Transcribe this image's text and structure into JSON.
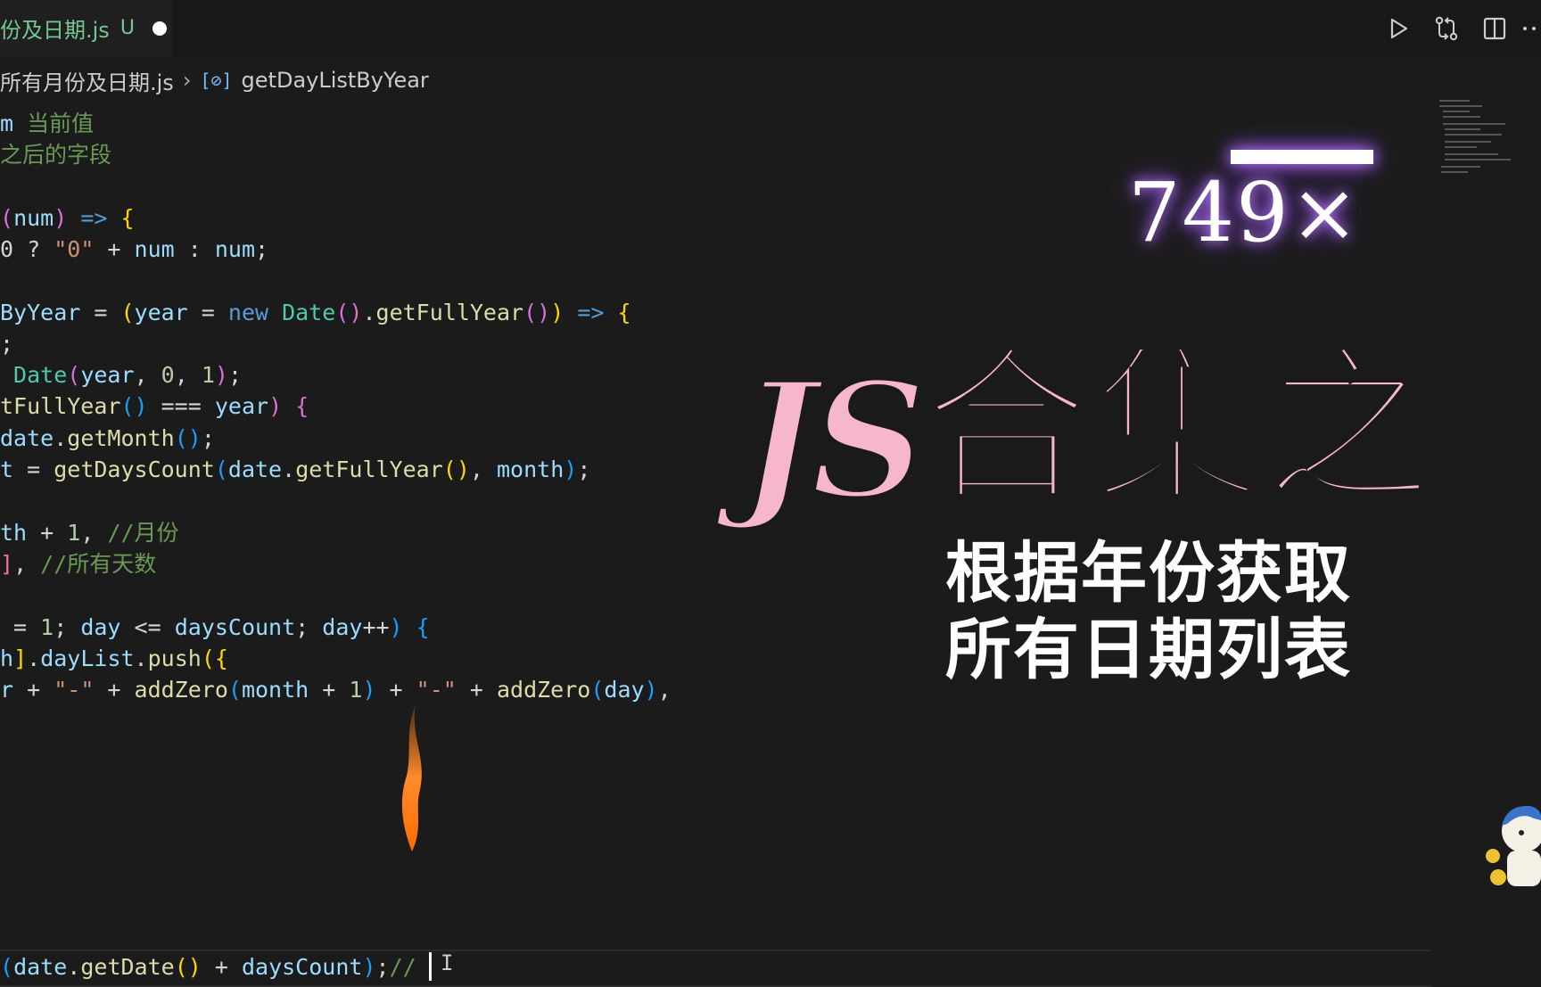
{
  "tab": {
    "name": "份及日期.js",
    "status": "U"
  },
  "breadcrumb": {
    "file": "所有月份及日期.js",
    "symbol": "getDayListByYear"
  },
  "code_lines": [
    [
      {
        "t": "m ",
        "c": "#9cdcfe"
      },
      {
        "t": "当前值",
        "c": "#6a9955"
      }
    ],
    [
      {
        "t": "之后的字段",
        "c": "#6a9955"
      }
    ],
    [],
    [
      {
        "t": "(",
        "c": "#da70d6"
      },
      {
        "t": "num",
        "c": "#9cdcfe"
      },
      {
        "t": ") ",
        "c": "#da70d6"
      },
      {
        "t": "=> ",
        "c": "#569cd6"
      },
      {
        "t": "{",
        "c": "#ffd700"
      }
    ],
    [
      {
        "t": "0 ? ",
        "c": "#d4d4d4"
      },
      {
        "t": "\"0\"",
        "c": "#ce9178"
      },
      {
        "t": " + ",
        "c": "#d4d4d4"
      },
      {
        "t": "num",
        "c": "#9cdcfe"
      },
      {
        "t": " : ",
        "c": "#d4d4d4"
      },
      {
        "t": "num",
        "c": "#9cdcfe"
      },
      {
        "t": ";",
        "c": "#d4d4d4"
      }
    ],
    [],
    [
      {
        "t": "ByYear",
        "c": "#9cdcfe"
      },
      {
        "t": " = ",
        "c": "#d4d4d4"
      },
      {
        "t": "(",
        "c": "#ffd700"
      },
      {
        "t": "year",
        "c": "#9cdcfe"
      },
      {
        "t": " = ",
        "c": "#d4d4d4"
      },
      {
        "t": "new ",
        "c": "#569cd6"
      },
      {
        "t": "Date",
        "c": "#4ec9b0"
      },
      {
        "t": "()",
        "c": "#da70d6"
      },
      {
        "t": ".",
        "c": "#d4d4d4"
      },
      {
        "t": "getFullYear",
        "c": "#dcdcaa"
      },
      {
        "t": "()",
        "c": "#da70d6"
      },
      {
        "t": ")",
        "c": "#ffd700"
      },
      {
        "t": " => ",
        "c": "#569cd6"
      },
      {
        "t": "{",
        "c": "#ffd700"
      }
    ],
    [
      {
        "t": ";",
        "c": "#d4d4d4"
      }
    ],
    [
      {
        "t": " Date",
        "c": "#4ec9b0"
      },
      {
        "t": "(",
        "c": "#da70d6"
      },
      {
        "t": "year",
        "c": "#9cdcfe"
      },
      {
        "t": ", ",
        "c": "#d4d4d4"
      },
      {
        "t": "0",
        "c": "#b5cea8"
      },
      {
        "t": ", ",
        "c": "#d4d4d4"
      },
      {
        "t": "1",
        "c": "#b5cea8"
      },
      {
        "t": ")",
        "c": "#da70d6"
      },
      {
        "t": ";",
        "c": "#d4d4d4"
      }
    ],
    [
      {
        "t": "tFullYear",
        "c": "#dcdcaa"
      },
      {
        "t": "()",
        "c": "#179fff"
      },
      {
        "t": " === ",
        "c": "#d4d4d4"
      },
      {
        "t": "year",
        "c": "#9cdcfe"
      },
      {
        "t": ") ",
        "c": "#da70d6"
      },
      {
        "t": "{",
        "c": "#da70d6"
      }
    ],
    [
      {
        "t": "date",
        "c": "#9cdcfe"
      },
      {
        "t": ".",
        "c": "#d4d4d4"
      },
      {
        "t": "getMonth",
        "c": "#dcdcaa"
      },
      {
        "t": "()",
        "c": "#179fff"
      },
      {
        "t": ";",
        "c": "#d4d4d4"
      }
    ],
    [
      {
        "t": "t",
        "c": "#9cdcfe"
      },
      {
        "t": " = ",
        "c": "#d4d4d4"
      },
      {
        "t": "getDaysCount",
        "c": "#dcdcaa"
      },
      {
        "t": "(",
        "c": "#179fff"
      },
      {
        "t": "date",
        "c": "#9cdcfe"
      },
      {
        "t": ".",
        "c": "#d4d4d4"
      },
      {
        "t": "getFullYear",
        "c": "#dcdcaa"
      },
      {
        "t": "()",
        "c": "#ffd700"
      },
      {
        "t": ", ",
        "c": "#d4d4d4"
      },
      {
        "t": "month",
        "c": "#9cdcfe"
      },
      {
        "t": ")",
        "c": "#179fff"
      },
      {
        "t": ";",
        "c": "#d4d4d4"
      }
    ],
    [],
    [
      {
        "t": "th",
        "c": "#9cdcfe"
      },
      {
        "t": " + ",
        "c": "#d4d4d4"
      },
      {
        "t": "1",
        "c": "#b5cea8"
      },
      {
        "t": ", ",
        "c": "#d4d4d4"
      },
      {
        "t": "//月份",
        "c": "#6a9955"
      }
    ],
    [
      {
        "t": "]",
        "c": "#ff6b9d"
      },
      {
        "t": ", ",
        "c": "#d4d4d4"
      },
      {
        "t": "//所有天数",
        "c": "#6a9955"
      }
    ],
    [],
    [
      {
        "t": " = ",
        "c": "#d4d4d4"
      },
      {
        "t": "1",
        "c": "#b5cea8"
      },
      {
        "t": "; ",
        "c": "#d4d4d4"
      },
      {
        "t": "day",
        "c": "#9cdcfe"
      },
      {
        "t": " <= ",
        "c": "#d4d4d4"
      },
      {
        "t": "daysCount",
        "c": "#9cdcfe"
      },
      {
        "t": "; ",
        "c": "#d4d4d4"
      },
      {
        "t": "day",
        "c": "#9cdcfe"
      },
      {
        "t": "++",
        "c": "#d4d4d4"
      },
      {
        "t": ") ",
        "c": "#179fff"
      },
      {
        "t": "{",
        "c": "#179fff"
      }
    ],
    [
      {
        "t": "h",
        "c": "#9cdcfe"
      },
      {
        "t": "]",
        "c": "#ffd700"
      },
      {
        "t": ".",
        "c": "#d4d4d4"
      },
      {
        "t": "dayList",
        "c": "#9cdcfe"
      },
      {
        "t": ".",
        "c": "#d4d4d4"
      },
      {
        "t": "push",
        "c": "#dcdcaa"
      },
      {
        "t": "({",
        "c": "#ffd700"
      }
    ],
    [
      {
        "t": "r",
        "c": "#9cdcfe"
      },
      {
        "t": " + ",
        "c": "#d4d4d4"
      },
      {
        "t": "\"-\"",
        "c": "#ce9178"
      },
      {
        "t": " + ",
        "c": "#d4d4d4"
      },
      {
        "t": "addZero",
        "c": "#dcdcaa"
      },
      {
        "t": "(",
        "c": "#179fff"
      },
      {
        "t": "month",
        "c": "#9cdcfe"
      },
      {
        "t": " + ",
        "c": "#d4d4d4"
      },
      {
        "t": "1",
        "c": "#b5cea8"
      },
      {
        "t": ")",
        "c": "#179fff"
      },
      {
        "t": " + ",
        "c": "#d4d4d4"
      },
      {
        "t": "\"-\"",
        "c": "#ce9178"
      },
      {
        "t": " + ",
        "c": "#d4d4d4"
      },
      {
        "t": "addZero",
        "c": "#dcdcaa"
      },
      {
        "t": "(",
        "c": "#179fff"
      },
      {
        "t": "day",
        "c": "#9cdcfe"
      },
      {
        "t": ")",
        "c": "#179fff"
      },
      {
        "t": ",",
        "c": "#d4d4d4"
      }
    ],
    [],
    [],
    [
      {
        "t": "(",
        "c": "#179fff"
      },
      {
        "t": "date",
        "c": "#9cdcfe"
      },
      {
        "t": ".",
        "c": "#d4d4d4"
      },
      {
        "t": "getDate",
        "c": "#dcdcaa"
      },
      {
        "t": "()",
        "c": "#ffd700"
      },
      {
        "t": " + ",
        "c": "#d4d4d4"
      },
      {
        "t": "daysCount",
        "c": "#9cdcfe"
      },
      {
        "t": ")",
        "c": "#179fff"
      },
      {
        "t": ";",
        "c": "#d4d4d4"
      },
      {
        "t": "//",
        "c": "#6a9955"
      }
    ]
  ],
  "overlay": {
    "view_count": "749×",
    "headline_js": "JS",
    "headline_cn": "合集之",
    "subtitle_line1": "根据年份获取",
    "subtitle_line2": "所有日期列表",
    "headline_color": "#f7b7cb",
    "glow_color": "#b066ff"
  }
}
